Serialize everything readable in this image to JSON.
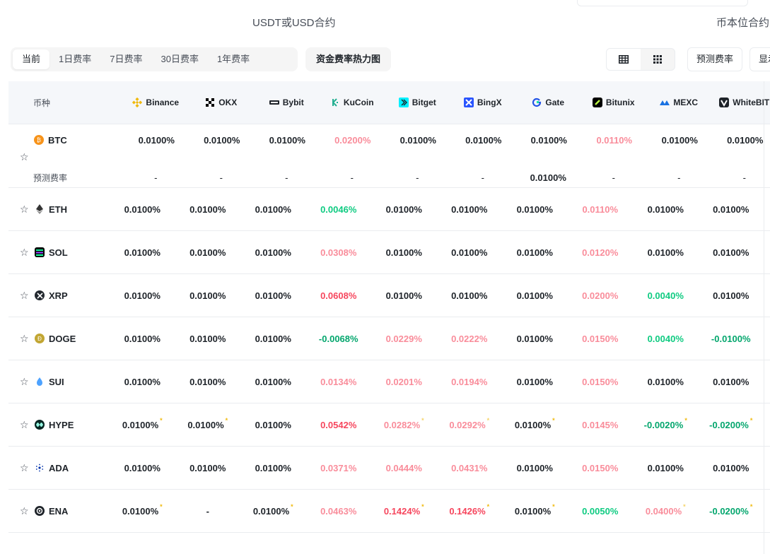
{
  "market_tabs": {
    "usdt": "USDT或USD合约",
    "coin": "币本位合约"
  },
  "periods": [
    "当前",
    "1日费率",
    "7日费率",
    "30日费率",
    "1年费率"
  ],
  "active_period": "当前",
  "heatmap_label": "资金费率热力图",
  "predict_label": "预测费率",
  "display_label": "显示",
  "table": {
    "symbol_header": "币种",
    "predicted_label": "预测费率",
    "exchanges": [
      "Binance",
      "OKX",
      "Bybit",
      "KuCoin",
      "Bitget",
      "BingX",
      "Gate",
      "Bitunix",
      "MEXC",
      "WhiteBIT"
    ],
    "rows": [
      {
        "symbol": "BTC",
        "rates": [
          "0.0100%",
          "0.0100%",
          "0.0100%",
          "0.0200%",
          "0.0100%",
          "0.0100%",
          "0.0100%",
          "0.0110%",
          "0.0100%",
          "0.0100%"
        ],
        "predicted": [
          "-",
          "-",
          "-",
          "-",
          "-",
          "-",
          "0.0100%",
          "-",
          "-",
          "-"
        ]
      },
      {
        "symbol": "ETH",
        "rates": [
          "0.0100%",
          "0.0100%",
          "0.0100%",
          "0.0046%",
          "0.0100%",
          "0.0100%",
          "0.0100%",
          "0.0110%",
          "0.0100%",
          "0.0100%"
        ]
      },
      {
        "symbol": "SOL",
        "rates": [
          "0.0100%",
          "0.0100%",
          "0.0100%",
          "0.0308%",
          "0.0100%",
          "0.0100%",
          "0.0100%",
          "0.0120%",
          "0.0100%",
          "0.0100%"
        ]
      },
      {
        "symbol": "XRP",
        "rates": [
          "0.0100%",
          "0.0100%",
          "0.0100%",
          "0.0608%",
          "0.0100%",
          "0.0100%",
          "0.0100%",
          "0.0200%",
          "0.0040%",
          "0.0100%"
        ]
      },
      {
        "symbol": "DOGE",
        "rates": [
          "0.0100%",
          "0.0100%",
          "0.0100%",
          "-0.0068%",
          "0.0229%",
          "0.0222%",
          "0.0100%",
          "0.0150%",
          "0.0040%",
          "-0.0100%"
        ]
      },
      {
        "symbol": "SUI",
        "rates": [
          "0.0100%",
          "0.0100%",
          "0.0100%",
          "0.0134%",
          "0.0201%",
          "0.0194%",
          "0.0100%",
          "0.0150%",
          "0.0100%",
          "0.0100%"
        ]
      },
      {
        "symbol": "HYPE",
        "rates": [
          "0.0100%",
          "0.0100%",
          "0.0100%",
          "0.0542%",
          "0.0282%",
          "0.0292%",
          "0.0100%",
          "0.0145%",
          "-0.0020%",
          "-0.0200%"
        ]
      },
      {
        "symbol": "ADA",
        "rates": [
          "0.0100%",
          "0.0100%",
          "0.0100%",
          "0.0371%",
          "0.0444%",
          "0.0431%",
          "0.0100%",
          "0.0150%",
          "0.0100%",
          "0.0100%"
        ]
      },
      {
        "symbol": "ENA",
        "rates": [
          "0.0100%",
          "-",
          "0.0100%",
          "0.0463%",
          "0.1424%",
          "0.1426%",
          "0.0100%",
          "0.0050%",
          "0.0400%",
          "-0.0200%"
        ]
      }
    ]
  },
  "colors": {
    "positive": "#f6465d",
    "negative": "#0ecb81",
    "negative_dark": "#03a66d",
    "mark": "#f0b90b",
    "btc": "#f7931a"
  }
}
